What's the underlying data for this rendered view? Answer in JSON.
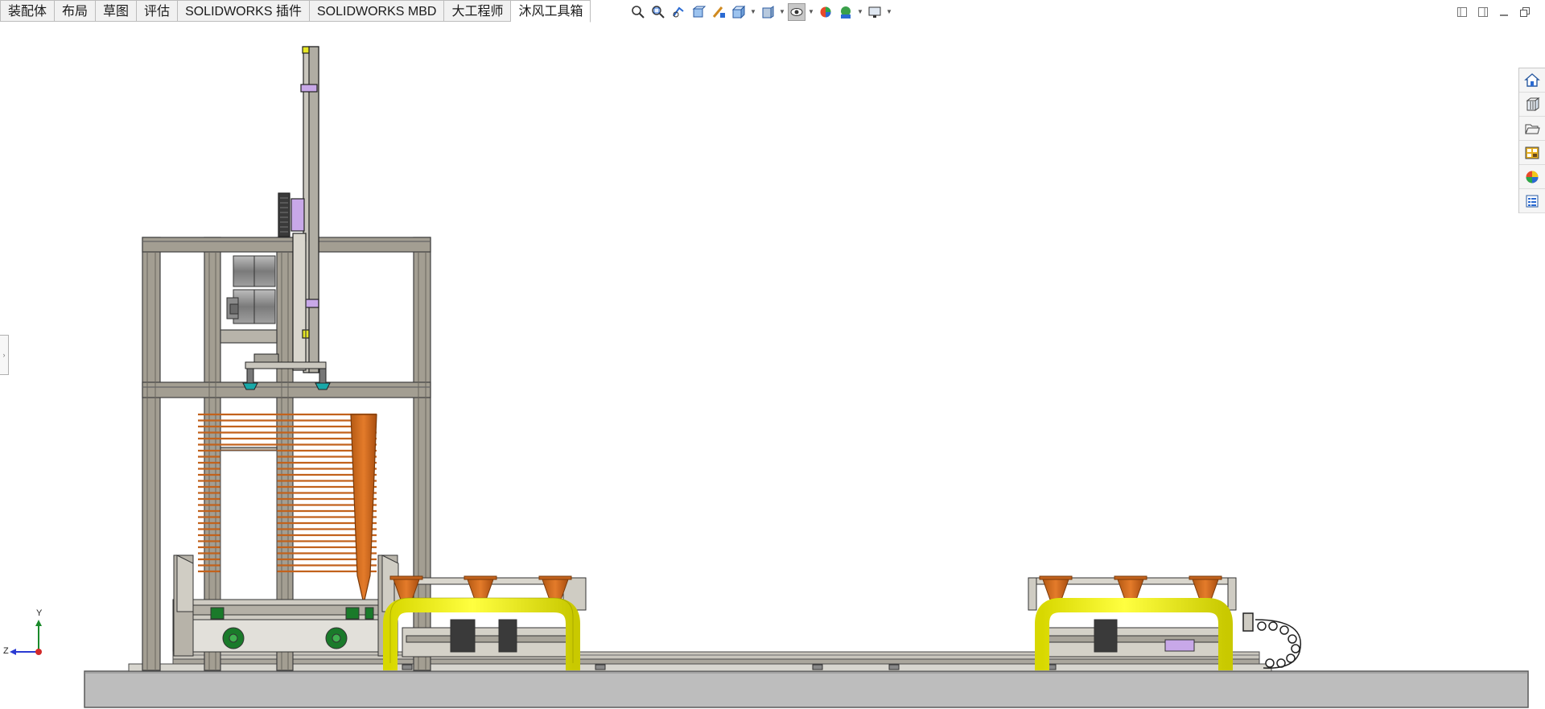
{
  "command_tabs": [
    "装配体",
    "布局",
    "草图",
    "评估",
    "SOLIDWORKS 插件",
    "SOLIDWORKS MBD",
    "大工程师",
    "沐风工具箱"
  ],
  "active_tab_index": 7,
  "view_toolbar": {
    "icons": [
      "zoom-to-fit-icon",
      "zoom-to-area-icon",
      "previous-view-icon",
      "section-view-icon",
      "dynamic-annotation-icon",
      "view-orientation-icon",
      "display-style-icon",
      "hide-show-items-icon",
      "edit-appearance-icon",
      "apply-scene-icon",
      "view-settings-icon"
    ]
  },
  "window_controls": [
    "tile-left-icon",
    "tile-right-icon",
    "minimize-icon",
    "restore-icon"
  ],
  "task_pane": [
    "home-icon",
    "design-library-icon",
    "file-explorer-icon",
    "view-palette-icon",
    "appearances-icon",
    "custom-properties-icon"
  ],
  "triad": {
    "y_label": "Y",
    "z_label": "Z"
  },
  "colors": {
    "frame": "#a39e92",
    "frame_edge": "#4a4a4a",
    "cup_orange": "#d2691e",
    "guard_yellow": "#f2f200",
    "ground": "#bdbdbd",
    "motor_gray": "#8e8e8e",
    "purple_block": "#c8a8e8",
    "green_wheel": "#1a7a2a"
  }
}
